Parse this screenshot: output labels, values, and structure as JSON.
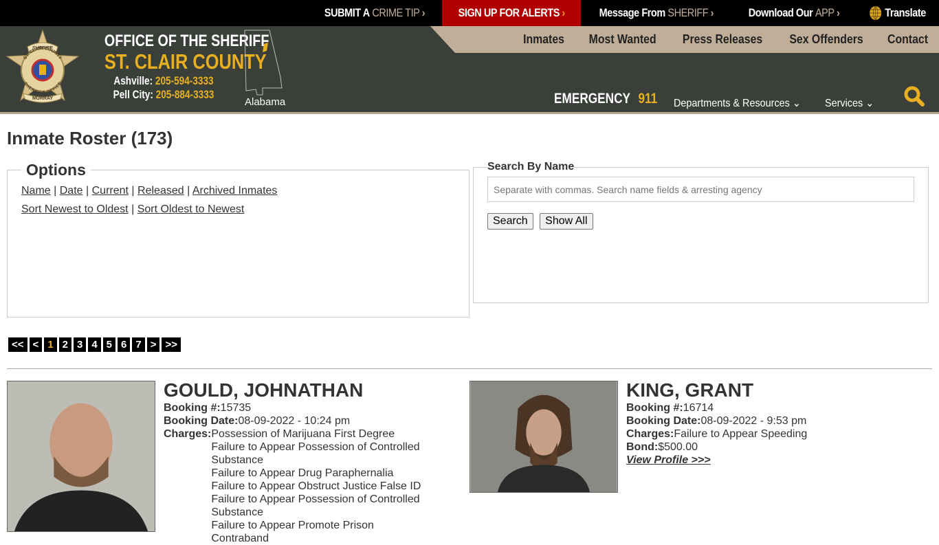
{
  "topbar": {
    "crime_tip": {
      "a": "SUBMIT A",
      "b": "CRIME TIP"
    },
    "alerts": "SIGN UP FOR ALERTS",
    "message": {
      "a": "Message From",
      "b": "SHERIFF"
    },
    "app": {
      "a": "Download Our",
      "b": "APP"
    },
    "translate": "Translate",
    "arrow": "›"
  },
  "header": {
    "line1": "OFFICE OF THE SHERIFF",
    "line2": "ST. CLAIR COUNTY",
    "phone1_label": "Ashville:",
    "phone1": "205-594-3333",
    "phone2_label": "Pell City:",
    "phone2": "205-884-3333",
    "state": "Alabama",
    "badge_text": [
      "SHERIFF",
      "ST. CLAIR COUNTY",
      "SHERIFF'S OFFICE",
      "MURRAY"
    ],
    "emergency_label": "EMERGENCY",
    "emergency_number": "911",
    "nav": [
      "Inmates",
      "Most Wanted",
      "Press Releases",
      "Sex Offenders",
      "Contact"
    ],
    "dropdowns": [
      "Departments & Resources",
      "Services"
    ],
    "colors": {
      "dark": "#3a4039",
      "tan": "#c0ae98",
      "gold": "#e8b020",
      "red": "#b00000"
    }
  },
  "page": {
    "title": "Inmate Roster (173)",
    "options": {
      "legend": "Options",
      "row1": [
        "Name",
        "Date",
        "Current",
        "Released",
        "Archived Inmates"
      ],
      "row2": [
        "Sort Newest to Oldest",
        "Sort Oldest to Newest"
      ],
      "sep": "|"
    },
    "search": {
      "legend": "Search By Name",
      "placeholder": "Separate with commas. Search name fields & arresting agency",
      "search_btn": "Search",
      "show_all_btn": "Show All"
    },
    "pager": [
      "<<",
      "<",
      "1",
      "2",
      "3",
      "4",
      "5",
      "6",
      "7",
      ">",
      ">>"
    ],
    "current_page": "1"
  },
  "inmates": [
    {
      "name": "GOULD, JOHNATHAN",
      "booking_label": "Booking #:",
      "booking": "15735",
      "date_label": "Booking Date:",
      "date": "08-09-2022 - 10:24 pm",
      "charges_label": "Charges:",
      "charges": [
        "Possession of Marijuana First Degree",
        "Failure to Appear Possession of Controlled Substance",
        "Failure to Appear Drug Paraphernalia",
        "Failure to Appear Obstruct Justice False ID",
        "Failure to Appear Possession of Controlled Substance",
        "Failure to Appear Promote Prison Contraband"
      ]
    },
    {
      "name": "KING, GRANT",
      "booking_label": "Booking #:",
      "booking": "16714",
      "date_label": "Booking Date:",
      "date": "08-09-2022 - 9:53 pm",
      "charges_label": "Charges:",
      "charges": [
        "Failure to Appear Speeding"
      ],
      "bond_label": "Bond:",
      "bond": "$500.00",
      "profile_link": "View Profile >>>"
    }
  ]
}
